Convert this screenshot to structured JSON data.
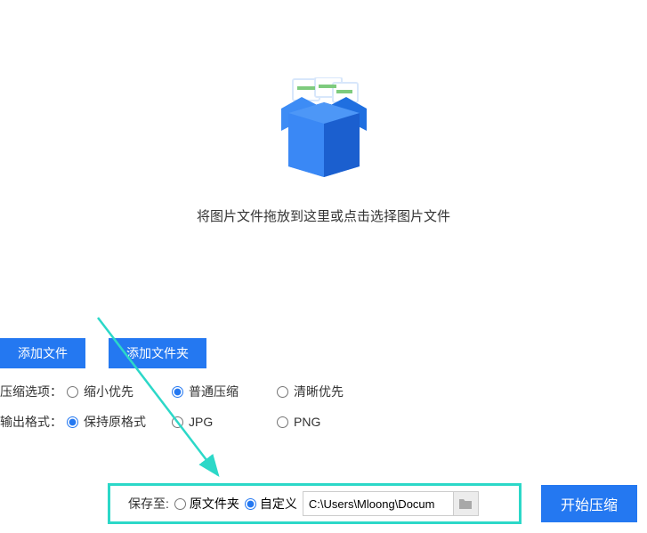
{
  "dropArea": {
    "text": "将图片文件拖放到这里或点击选择图片文件"
  },
  "toolbar": {
    "addFile": "添加文件",
    "addFolder": "添加文件夹"
  },
  "compressOption": {
    "label": "压缩选项：",
    "shrink": "缩小优先",
    "normal": "普通压缩",
    "clarity": "清晰优先"
  },
  "outputFormat": {
    "label": "输出格式：",
    "original": "保持原格式",
    "jpg": "JPG",
    "png": "PNG"
  },
  "saveTo": {
    "label": "保存至:",
    "originalFolder": "原文件夹",
    "custom": "自定义",
    "path": "C:\\Users\\Mloong\\Docum"
  },
  "actions": {
    "startCompress": "开始压缩"
  }
}
